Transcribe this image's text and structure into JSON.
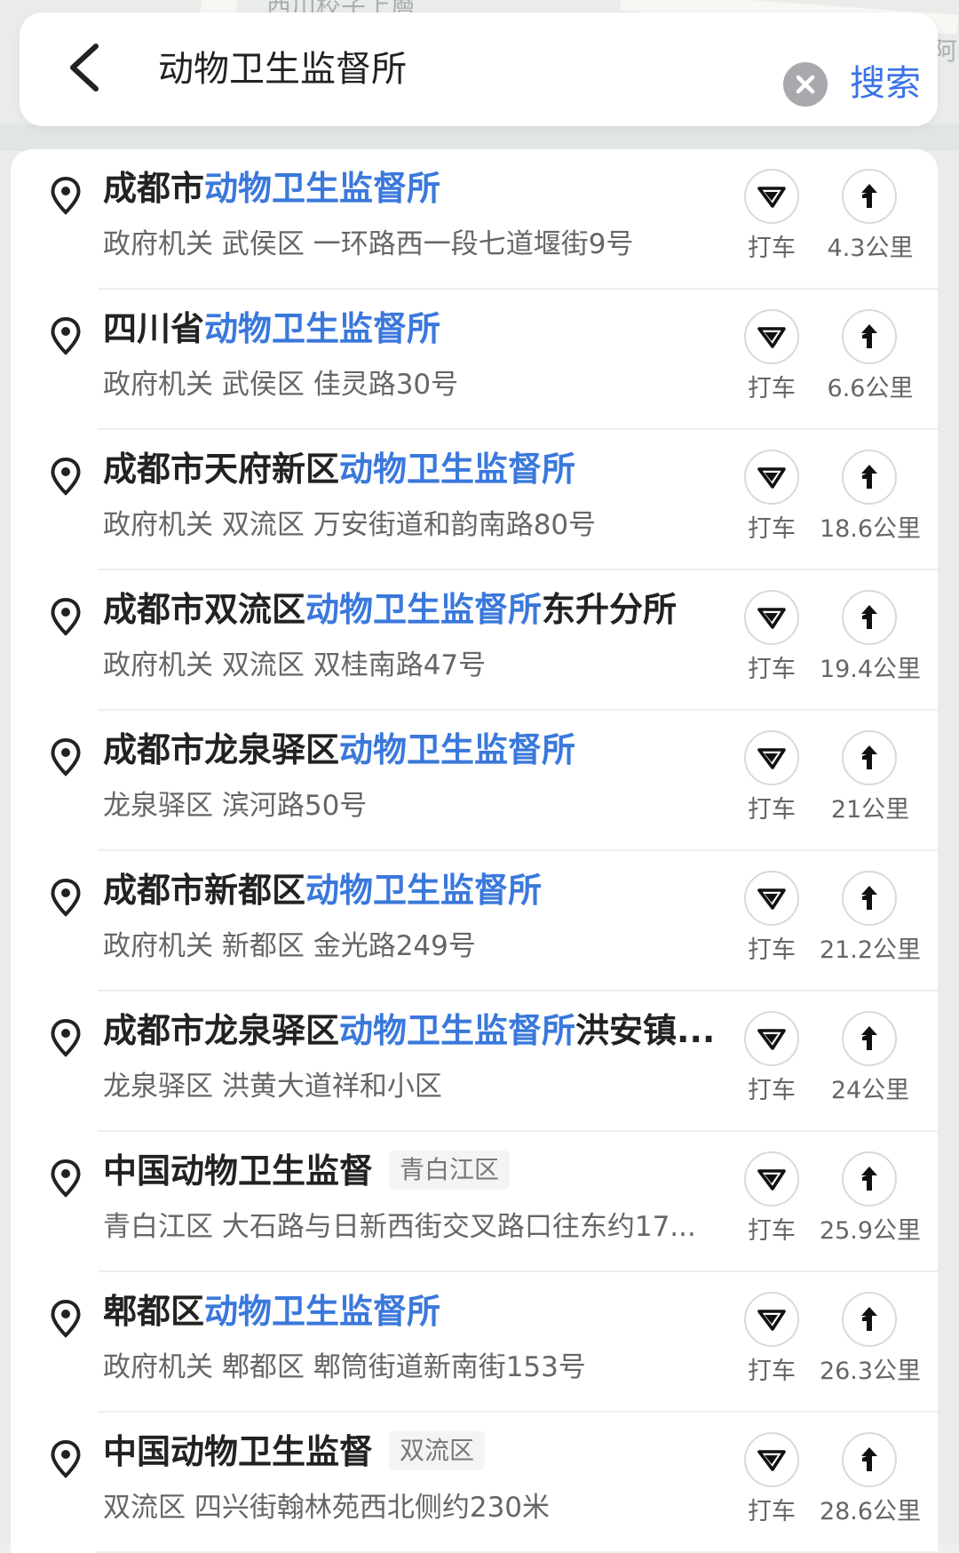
{
  "map": {
    "labels": [
      "西川校子上層",
      "阿"
    ]
  },
  "search": {
    "query": "动物卫生监督所",
    "button_label": "搜索"
  },
  "results": [
    {
      "title_prefix": "成都市",
      "title_hl": "动物卫生监督所",
      "title_suffix": "",
      "region_tag": "",
      "subtitle": "政府机关  武侯区  一环路西一段七道堰街9号",
      "taxi_label": "打车",
      "distance": "4.3公里"
    },
    {
      "title_prefix": "四川省",
      "title_hl": "动物卫生监督所",
      "title_suffix": "",
      "region_tag": "",
      "subtitle": "政府机关  武侯区  佳灵路30号",
      "taxi_label": "打车",
      "distance": "6.6公里"
    },
    {
      "title_prefix": "成都市天府新区",
      "title_hl": "动物卫生监督所",
      "title_suffix": "",
      "region_tag": "",
      "subtitle": "政府机关  双流区  万安街道和韵南路80号",
      "taxi_label": "打车",
      "distance": "18.6公里"
    },
    {
      "title_prefix": "成都市双流区",
      "title_hl": "动物卫生监督所",
      "title_suffix": "东升分所",
      "region_tag": "",
      "subtitle": "政府机关  双流区  双桂南路47号",
      "taxi_label": "打车",
      "distance": "19.4公里"
    },
    {
      "title_prefix": "成都市龙泉驿区",
      "title_hl": "动物卫生监督所",
      "title_suffix": "",
      "region_tag": "",
      "subtitle": "龙泉驿区  滨河路50号",
      "taxi_label": "打车",
      "distance": "21公里"
    },
    {
      "title_prefix": "成都市新都区",
      "title_hl": "动物卫生监督所",
      "title_suffix": "",
      "region_tag": "",
      "subtitle": "政府机关  新都区  金光路249号",
      "taxi_label": "打车",
      "distance": "21.2公里"
    },
    {
      "title_prefix": "成都市龙泉驿区",
      "title_hl": "动物卫生监督所",
      "title_suffix": "洪安镇...",
      "region_tag": "",
      "subtitle": "龙泉驿区  洪黄大道祥和小区",
      "taxi_label": "打车",
      "distance": "24公里"
    },
    {
      "title_prefix": "中国动物卫生监督",
      "title_hl": "",
      "title_suffix": "",
      "region_tag": "青白江区",
      "subtitle": "青白江区  大石路与日新西街交叉路口往东约17...",
      "taxi_label": "打车",
      "distance": "25.9公里"
    },
    {
      "title_prefix": "郫都区",
      "title_hl": "动物卫生监督所",
      "title_suffix": "",
      "region_tag": "",
      "subtitle": "政府机关  郫都区  郫筒街道新南街153号",
      "taxi_label": "打车",
      "distance": "26.3公里"
    },
    {
      "title_prefix": "中国动物卫生监督",
      "title_hl": "",
      "title_suffix": "",
      "region_tag": "双流区",
      "subtitle": "双流区  四兴街翰林苑西北侧约230米",
      "taxi_label": "打车",
      "distance": "28.6公里"
    }
  ],
  "icons": {
    "back": "chevron-left-icon",
    "clear": "clear-x-icon",
    "pin": "location-pin-icon",
    "taxi": "taxi-icon",
    "navigate": "navigate-turn-icon"
  },
  "colors": {
    "accent": "#3a78db",
    "search_button": "#3a73e6",
    "title": "#222222",
    "subtitle": "#666666"
  }
}
